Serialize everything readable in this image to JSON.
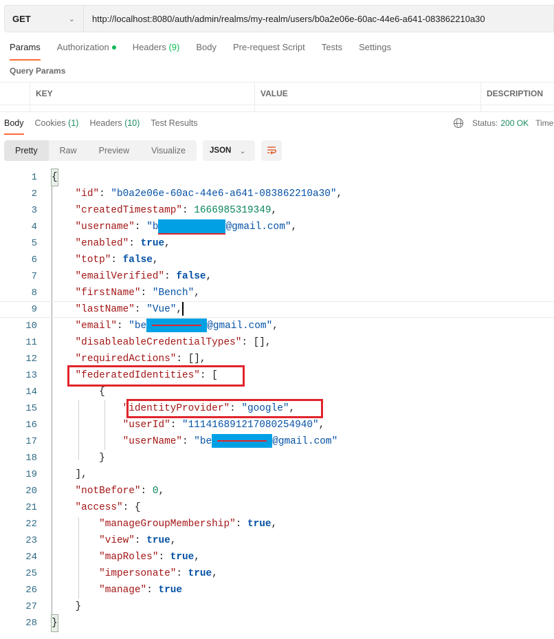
{
  "request": {
    "method": "GET",
    "url": "http://localhost:8080/auth/admin/realms/my-realm/users/b0a2e06e-60ac-44e6-a641-083862210a30"
  },
  "request_tabs": [
    {
      "label": "Params",
      "active": true
    },
    {
      "label": "Authorization",
      "dot": true
    },
    {
      "label": "Headers",
      "count": "(9)"
    },
    {
      "label": "Body"
    },
    {
      "label": "Pre-request Script"
    },
    {
      "label": "Tests"
    },
    {
      "label": "Settings"
    }
  ],
  "query_params": {
    "title": "Query Params",
    "columns": [
      "KEY",
      "VALUE",
      "DESCRIPTION"
    ]
  },
  "response_tabs": [
    {
      "label": "Body",
      "active": true
    },
    {
      "label": "Cookies",
      "count": "(1)"
    },
    {
      "label": "Headers",
      "count": "(10)"
    },
    {
      "label": "Test Results"
    }
  ],
  "status": {
    "icon": "globe-icon",
    "label": "Status:",
    "value": "200 OK",
    "time_label": "Time"
  },
  "view_modes": [
    "Pretty",
    "Raw",
    "Preview",
    "Visualize"
  ],
  "active_view_mode": "Pretty",
  "format": "JSON",
  "wrap_icon": "wrap-lines-icon",
  "accent_color": "#ff6c37",
  "highlight_color": "#e1242c",
  "code": {
    "id": "b0a2e06e-60ac-44e6-a641-083862210a30",
    "createdTimestamp": "1666985319349",
    "username_prefix": "b",
    "username_suffix": "@gmail.com",
    "enabled": "true",
    "totp": "false",
    "emailVerified": "false",
    "firstName": "Bench",
    "lastName": "Vue",
    "email_prefix": "be",
    "email_suffix": "@gmail.com",
    "federated_identity": {
      "identityProvider": "google",
      "userId": "111416891217080254940",
      "userName_prefix": "be",
      "userName_suffix": "@gmail.com"
    },
    "notBefore": "0",
    "access": {
      "manageGroupMembership": "true",
      "view": "true",
      "mapRoles": "true",
      "impersonate": "true",
      "manage": "true"
    }
  },
  "line_numbers": [
    "1",
    "2",
    "3",
    "4",
    "5",
    "6",
    "7",
    "8",
    "9",
    "10",
    "11",
    "12",
    "13",
    "14",
    "15",
    "16",
    "17",
    "18",
    "19",
    "20",
    "21",
    "22",
    "23",
    "24",
    "25",
    "26",
    "27",
    "28"
  ]
}
